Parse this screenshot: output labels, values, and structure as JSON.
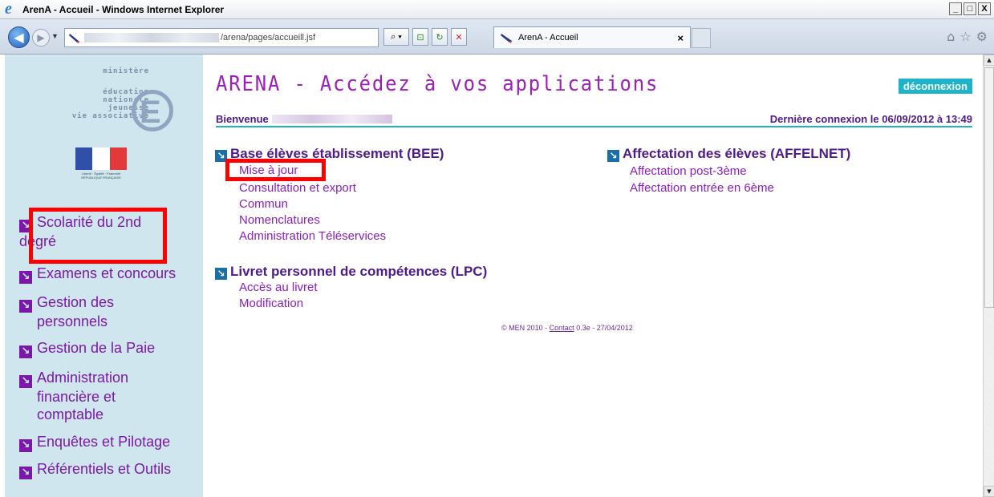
{
  "window": {
    "title": "ArenA - Accueil - Windows Internet Explorer",
    "minimize": "_",
    "maximize": "□",
    "close": "X"
  },
  "browser": {
    "url": "/arena/pages/accueill.jsf",
    "tab_label": "ArenA - Accueil",
    "tab_close": "×",
    "icons": [
      "back-icon",
      "forward-icon",
      "search-icon",
      "refresh-icon",
      "stop-icon",
      "home-icon",
      "favorites-icon",
      "settings-icon"
    ]
  },
  "sidebar": {
    "logo": {
      "ministere": "ministère",
      "lines": [
        "éducation",
        "nationale",
        "jeunesse",
        "vie associative"
      ],
      "republique": "Liberté · Égalité · Fraternité RÉPUBLIQUE FRANÇAISE"
    },
    "items": [
      {
        "label_1": "Scolarité du 2nd",
        "label_2": "degré"
      },
      {
        "label_1": "Examens et concours",
        "label_2": ""
      },
      {
        "label_1": "Gestion des",
        "label_2": "personnels"
      },
      {
        "label_1": "Gestion de la Paie",
        "label_2": ""
      },
      {
        "label_1": "Administration",
        "label_2": "financière et",
        "label_3": "comptable"
      },
      {
        "label_1": "Enquêtes et Pilotage",
        "label_2": ""
      },
      {
        "label_1": "Référentiels et Outils",
        "label_2": ""
      }
    ]
  },
  "main": {
    "title": "ARENA - Accédez à vos applications",
    "logout": "déconnexion",
    "welcome": "Bienvenue",
    "last_connection": "Dernière connexion le 06/09/2012 à  13:49",
    "sections": [
      {
        "title": "Base élèves établissement (BEE)",
        "links": [
          "Mise à jour",
          "Consultation et export",
          "Commun",
          "Nomenclatures",
          "Administration Téléservices"
        ]
      },
      {
        "title": "Affectation des élèves (AFFELNET)",
        "links": [
          "Affectation post-3ème",
          "Affectation entrée en 6ème"
        ]
      },
      {
        "title": "Livret personnel de compétences (LPC)",
        "links": [
          "Accès au livret",
          "Modification"
        ]
      }
    ],
    "footer": {
      "prefix": "© MEN 2010 - ",
      "contact": "Contact",
      "suffix": " 0.3e - 27/04/2012"
    }
  },
  "colors": {
    "accent_purple": "#4e1a8c",
    "link_purple": "#8b1ec0",
    "cyan": "#1fb3c9",
    "sidebar_bg": "#cfe6ee",
    "highlight_red": "#ff0000"
  }
}
